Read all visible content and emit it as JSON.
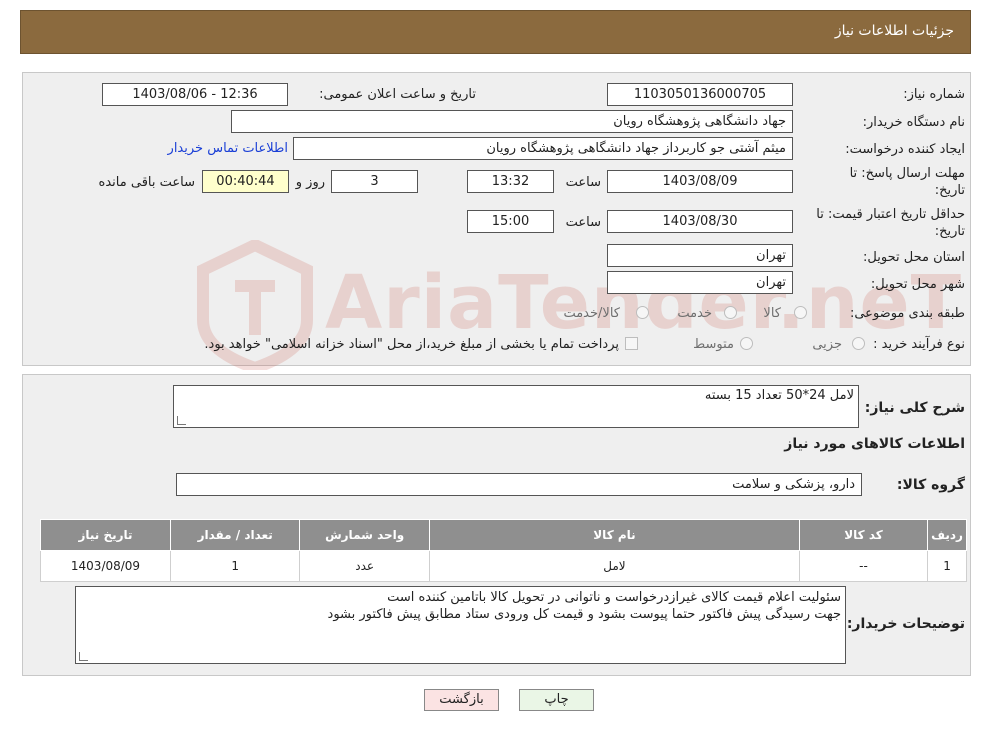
{
  "header": {
    "title": "جزئیات اطلاعات نیاز"
  },
  "form": {
    "need_number_label": "شماره نیاز:",
    "need_number": "1103050136000705",
    "announce_label": "تاریخ و ساعت اعلان عمومی:",
    "announce_value": "1403/08/06 - 12:36",
    "buyer_org_label": "نام دستگاه خریدار:",
    "buyer_org": "جهاد دانشگاهی پژوهشگاه رویان",
    "creator_label": "ایجاد کننده درخواست:",
    "creator": "میثم  آشتی جو کاربرداز جهاد دانشگاهی پژوهشگاه رویان",
    "contact_link": "اطلاعات تماس خریدار",
    "deadline_label_1": "مهلت ارسال پاسخ: تا",
    "deadline_label_2": "تاریخ:",
    "deadline_date": "1403/08/09",
    "time_label": "ساعت",
    "deadline_time": "13:32",
    "days": "3",
    "days_label": "روز و",
    "remaining": "00:40:44",
    "remaining_label": "ساعت باقی مانده",
    "validity_label_1": "حداقل تاریخ اعتبار قیمت: تا",
    "validity_label_2": "تاریخ:",
    "validity_date": "1403/08/30",
    "validity_time_label": "ساعت",
    "validity_time": "15:00",
    "province_label": "استان محل تحویل:",
    "province": "تهران",
    "city_label": "شهر محل تحویل:",
    "city": "تهران",
    "category_label": "طبقه بندی موضوعی:",
    "category_options": [
      "کالا",
      "خدمت",
      "کالا/خدمت"
    ],
    "purchase_type_label": "نوع فرآیند خرید :",
    "purchase_options": [
      "جزیی",
      "متوسط"
    ],
    "payment_note": "پرداخت تمام یا بخشی از مبلغ خرید،از محل \"اسناد خزانه اسلامی\" خواهد بود."
  },
  "watermark": {
    "text": "AriaTender.neT"
  },
  "details": {
    "general_desc_label": "شرح کلی نیاز:",
    "general_desc": "لامل 24*50 تعداد 15 بسته",
    "goods_info_title": "اطلاعات کالاهای مورد نیاز",
    "goods_group_label": "گروه کالا:",
    "goods_group": "دارو، پزشکی و سلامت",
    "table": {
      "headers": [
        "ردیف",
        "کد کالا",
        "نام کالا",
        "واحد شمارش",
        "تعداد / مقدار",
        "تاریخ نیاز"
      ],
      "rows": [
        [
          "1",
          "--",
          "لامل",
          "عدد",
          "1",
          "1403/08/09"
        ]
      ]
    },
    "buyer_notes_label": "توضیحات خریدار:",
    "buyer_notes_line1": "سئولیت اعلام قیمت کالای غیرازدرخواست و ناتوانی در تحویل کالا باتامین کننده است",
    "buyer_notes_line2": "جهت رسیدگی پیش فاکتور حتما پیوست بشود و قیمت کل ورودی ستاد مطابق پیش فاکتور بشود"
  },
  "buttons": {
    "print": "چاپ",
    "back": "بازگشت"
  }
}
